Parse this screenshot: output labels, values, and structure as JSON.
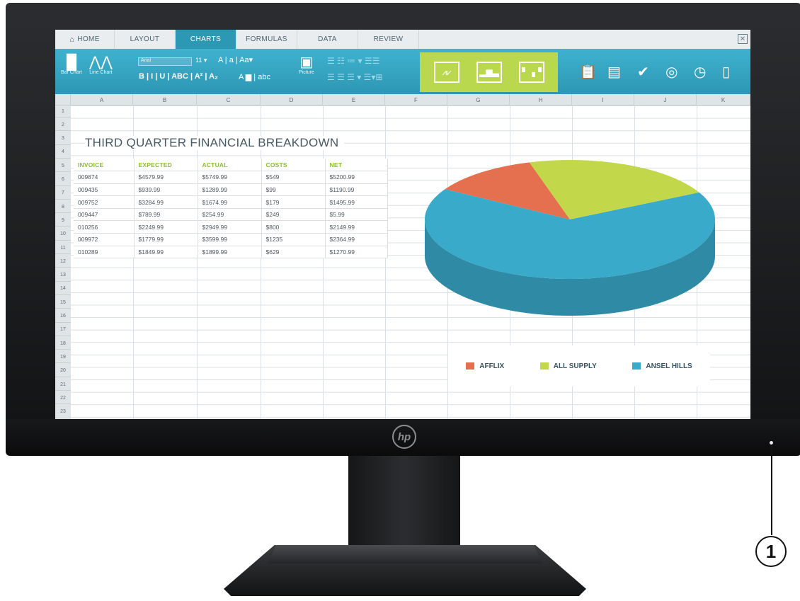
{
  "tabs": [
    {
      "label": "HOME",
      "icon": "home-icon"
    },
    {
      "label": "LAYOUT"
    },
    {
      "label": "CHARTS",
      "active": true
    },
    {
      "label": "FORMULAS"
    },
    {
      "label": "DATA"
    },
    {
      "label": "REVIEW"
    }
  ],
  "ribbon": {
    "bar_chart": "Bar Chart",
    "line_chart": "Line Chart",
    "font_name": "Arial",
    "font_size": "11",
    "picture": "Picture",
    "fmt_row1": "A  |  a  |  Aa▾",
    "fmt_row2": "B  |  I  |  U  |  ABC  |  A²  |  A₂",
    "fmt_row3": "A ▆  |  abc"
  },
  "columns": [
    "A",
    "B",
    "C",
    "D",
    "E",
    "F",
    "G",
    "H",
    "I",
    "J",
    "K"
  ],
  "rows": [
    "1",
    "2",
    "3",
    "4",
    "5",
    "6",
    "7",
    "8",
    "9",
    "10",
    "11",
    "12",
    "13",
    "14",
    "15",
    "16",
    "17",
    "18",
    "19",
    "20",
    "21",
    "22",
    "23"
  ],
  "sheet": {
    "title": "THIRD QUARTER FINANCIAL BREAKDOWN",
    "headers": [
      "INVOICE",
      "EXPECTED",
      "ACTUAL",
      "COSTS",
      "NET"
    ],
    "rows": [
      [
        "009874",
        "$4579.99",
        "$5749.99",
        "$549",
        "$5200.99"
      ],
      [
        "009435",
        "$939.99",
        "$1289.99",
        "$99",
        "$1190.99"
      ],
      [
        "009752",
        "$3284.99",
        "$1674.99",
        "$179",
        "$1495.99"
      ],
      [
        "009447",
        "$789.99",
        "$254.99",
        "$249",
        "$5.99"
      ],
      [
        "010256",
        "$2249.99",
        "$2949.99",
        "$800",
        "$2149.99"
      ],
      [
        "009972",
        "$1779.99",
        "$3599.99",
        "$1235",
        "$2364.99"
      ],
      [
        "010289",
        "$1849.99",
        "$1899.99",
        "$629",
        "$1270.99"
      ]
    ]
  },
  "chart_data": {
    "type": "pie",
    "categories": [
      "AFFLIX",
      "ALL SUPPLY",
      "ANSEL HILLS"
    ],
    "values": [
      12,
      22,
      66
    ],
    "colors": [
      "#e4704f",
      "#c2d84a",
      "#39aac9"
    ],
    "legend_position": "bottom"
  },
  "device": {
    "callout": "1"
  }
}
